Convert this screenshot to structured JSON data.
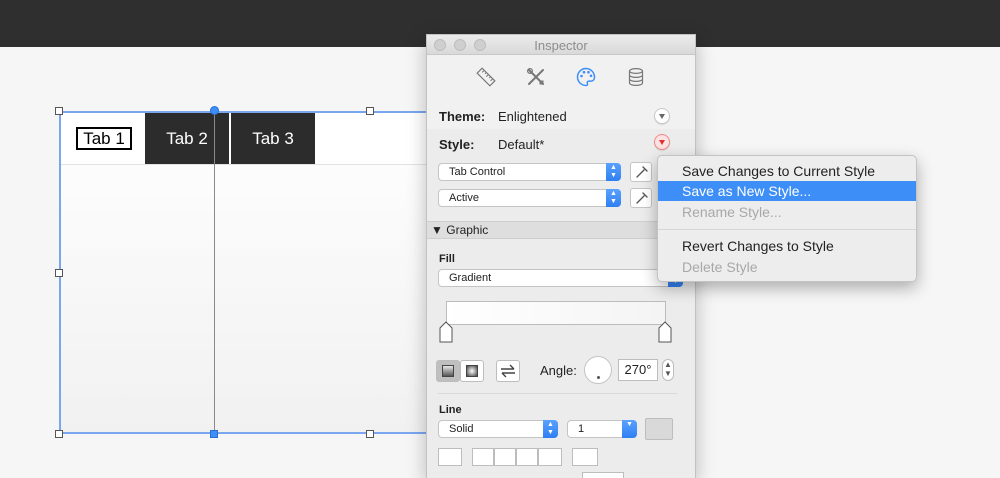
{
  "inspector": {
    "title": "Inspector",
    "toolbar_icons": [
      "ruler-icon",
      "tools-icon",
      "palette-icon",
      "database-icon"
    ],
    "active_icon": "palette-icon",
    "theme_label": "Theme:",
    "theme_value": "Enlightened",
    "style_label": "Style:",
    "style_value": "Default*",
    "element_select": "Tab Control",
    "state_select": "Active",
    "graphic_section": "Graphic",
    "fill_label": "Fill",
    "fill_select": "Gradient",
    "angle_label": "Angle:",
    "angle_value": "270°",
    "line_label": "Line",
    "line_style_select": "Solid",
    "line_width_select": "1"
  },
  "style_menu": {
    "items": [
      {
        "label": "Save Changes to Current Style",
        "enabled": true,
        "highlighted": false
      },
      {
        "label": "Save as New Style...",
        "enabled": true,
        "highlighted": true
      },
      {
        "label": "Rename Style...",
        "enabled": false,
        "highlighted": false
      },
      {
        "label": "Revert Changes to Style",
        "enabled": true,
        "highlighted": false
      },
      {
        "label": "Delete Style",
        "enabled": false,
        "highlighted": false
      }
    ]
  },
  "canvas": {
    "tabs": [
      "Tab 1",
      "Tab 2",
      "Tab 3"
    ],
    "selected_tab": "Tab 1"
  },
  "colors": {
    "accent": "#3d8ef7",
    "topbar": "#2f2f2f",
    "tab_dark": "#2c2c2c",
    "selection": "#7aa6f0"
  }
}
